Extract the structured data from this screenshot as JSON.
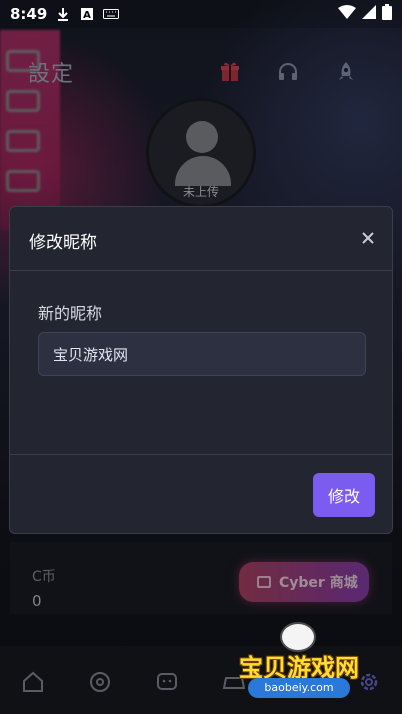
{
  "status_bar": {
    "time": "8:49",
    "left_icons": [
      "download-icon",
      "font-a-icon",
      "keyboard-icon"
    ],
    "right_icons": [
      "wifi-icon",
      "signal-icon",
      "battery-icon"
    ]
  },
  "header": {
    "title": "設定",
    "icons": [
      "gift-icon",
      "headset-icon",
      "rocket-icon"
    ]
  },
  "avatar": {
    "label": "未上传"
  },
  "modal": {
    "title": "修改昵称",
    "field_label": "新的昵称",
    "input_value": "宝贝游戏网",
    "submit_label": "修改"
  },
  "wallet": {
    "coin_label": "C币",
    "coin_value": "0",
    "shop_button_label": "Cyber 商城"
  },
  "bottom_nav": {
    "items": [
      "home-icon",
      "explore-icon",
      "chat-icon",
      "controller-icon",
      "settings-icon"
    ]
  },
  "watermark": {
    "text": "宝贝游戏网",
    "url": "baobeiy.com"
  },
  "colors": {
    "accent": "#7b5cf0",
    "modal_bg": "#232530",
    "shop_button_start": "#b04263",
    "shop_button_end": "#8a3fb0"
  }
}
